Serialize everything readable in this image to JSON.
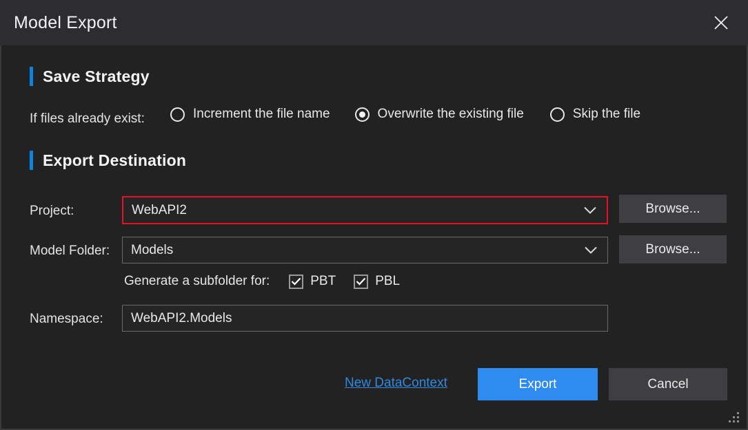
{
  "window": {
    "title": "Model Export",
    "close_icon": "close-icon",
    "resize_grip_icon": "resize-grip-icon"
  },
  "save_strategy": {
    "heading": "Save Strategy",
    "prompt_label": "If files already exist:",
    "options": [
      {
        "label": "Increment the file name",
        "selected": false
      },
      {
        "label": "Overwrite the existing file",
        "selected": true
      },
      {
        "label": "Skip the file",
        "selected": false
      }
    ]
  },
  "export_destination": {
    "heading": "Export Destination",
    "project": {
      "label": "Project:",
      "value": "WebAPI2",
      "invalid": true,
      "dropdown_icon": "chevron-down-icon",
      "browse_label": "Browse..."
    },
    "model_folder": {
      "label": "Model Folder:",
      "value": "Models",
      "dropdown_icon": "chevron-down-icon",
      "browse_label": "Browse..."
    },
    "subfolder": {
      "label": "Generate a subfolder for:",
      "options": [
        {
          "label": "PBT",
          "checked": true
        },
        {
          "label": "PBL",
          "checked": true
        }
      ]
    },
    "namespace": {
      "label": "Namespace:",
      "value": "WebAPI2.Models"
    }
  },
  "footer": {
    "new_datacontext_link": "New DataContext",
    "export_label": "Export",
    "cancel_label": "Cancel"
  },
  "colors": {
    "accent_blue": "#0a84dd",
    "primary_button": "#2e8bf0",
    "error_border": "#e81123",
    "link": "#2f8ae0",
    "titlebar_bg": "#2d2d30",
    "body_bg": "#222222"
  }
}
